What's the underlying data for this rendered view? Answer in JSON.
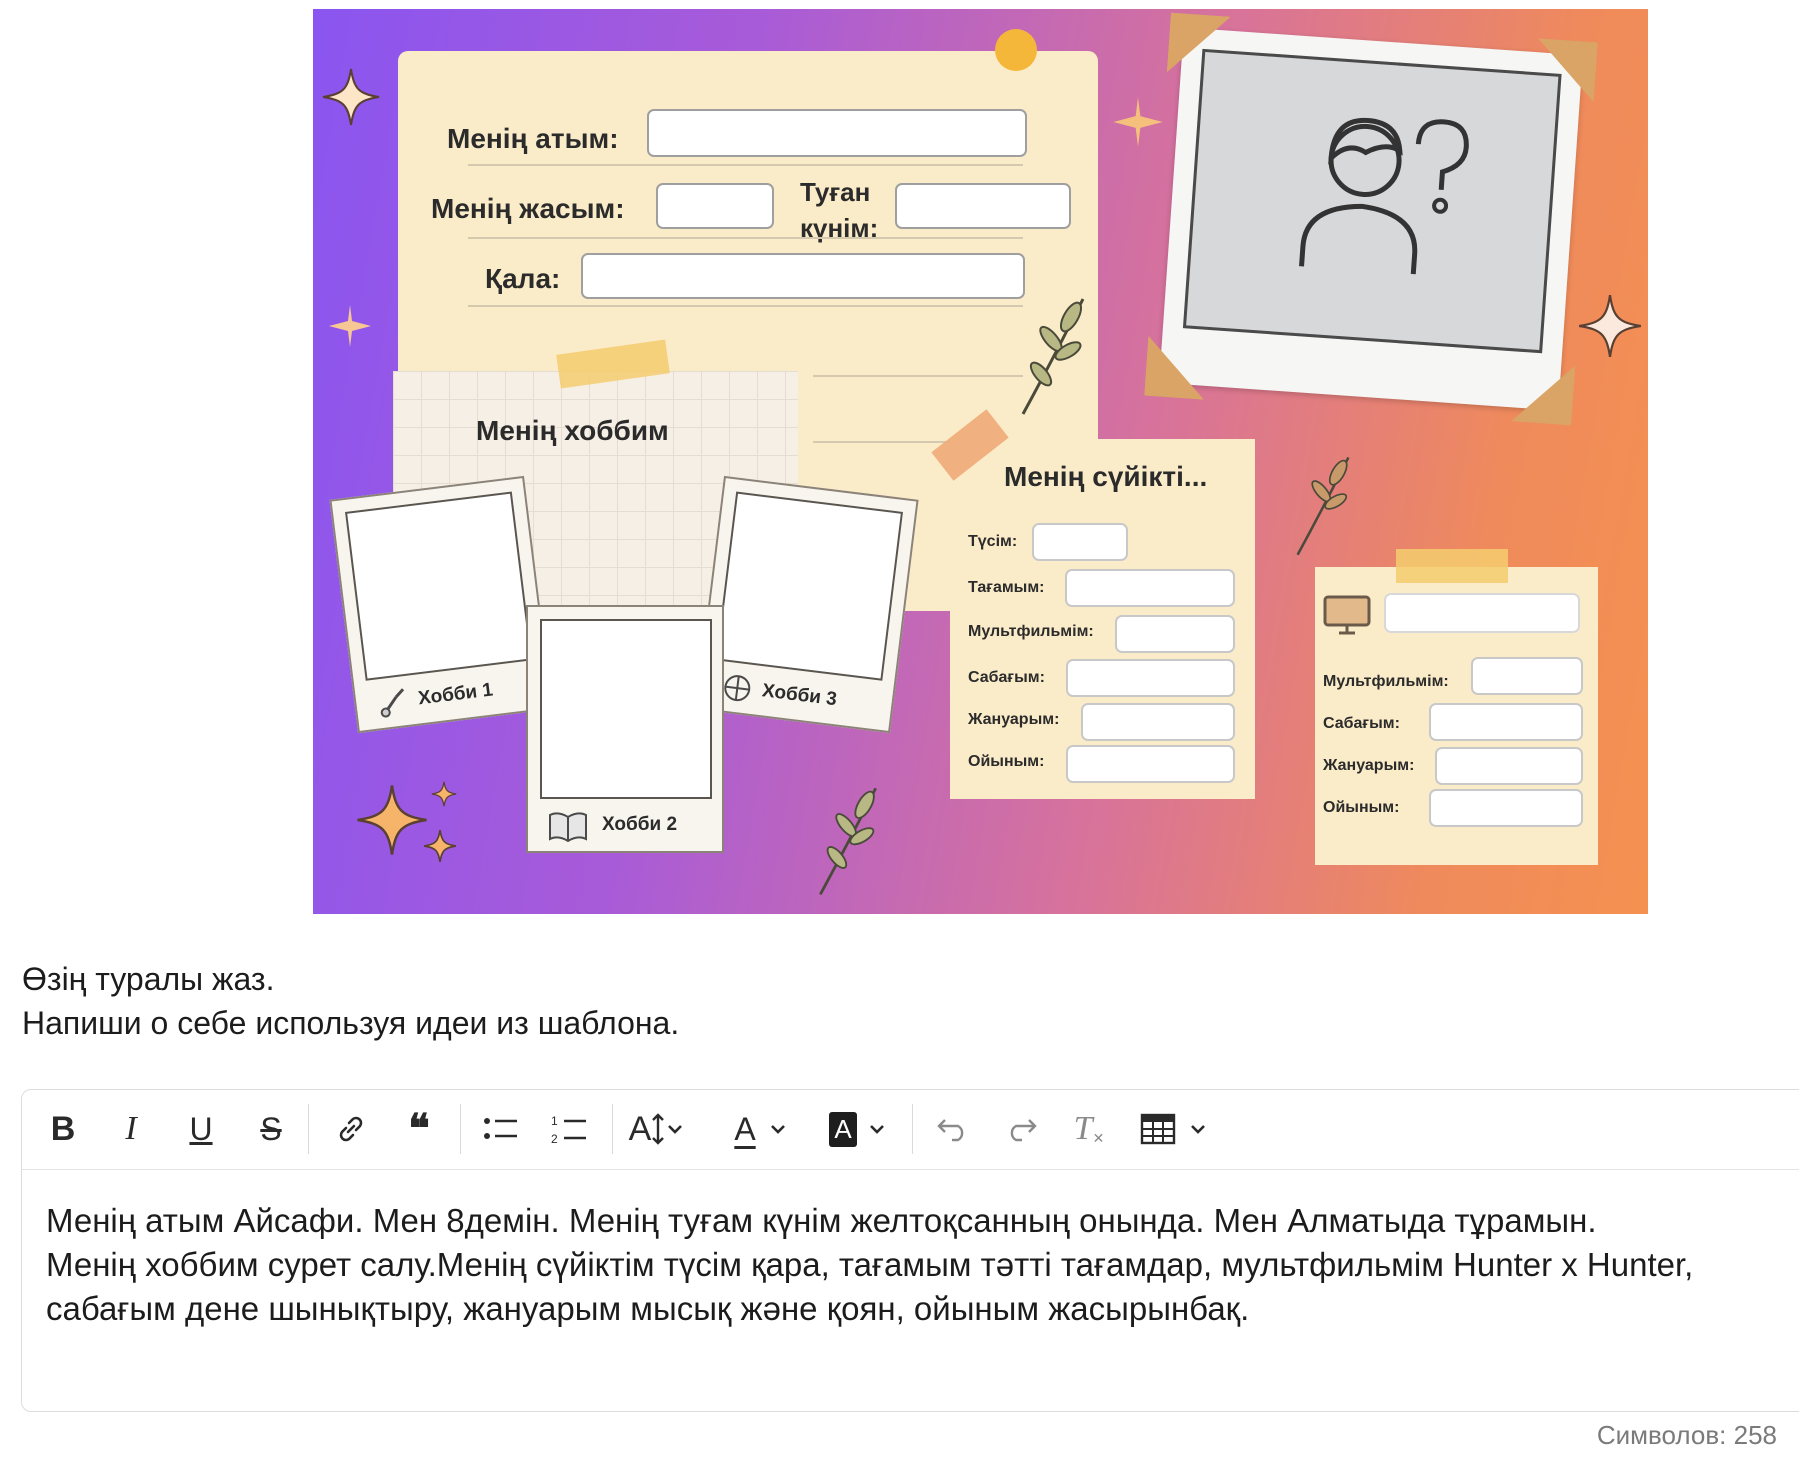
{
  "template": {
    "name_label": "Менің атым:",
    "age_label": "Менің жасым:",
    "birthday_label_line1": "Туған",
    "birthday_label_line2": "күнім:",
    "city_label": "Қала:",
    "hobby_title": "Менің хоббим",
    "hobbies": [
      "Хобби 1",
      "Хобби 2",
      "Хобби 3"
    ],
    "favorites_title": "Менің сүйікті...",
    "favorites_left": [
      "Түсім:",
      "Тағамым:",
      "Мультфильмім:",
      "Сабағым:",
      "Жануарым:",
      "Ойыным:"
    ],
    "favorites_right": [
      "Мультфильмім:",
      "Сабағым:",
      "Жануарым:",
      "Ойыным:"
    ]
  },
  "instructions": {
    "line1": "Өзің туралы жаз.",
    "line2": "Напиши о себе используя идеи из шаблона."
  },
  "toolbar": {
    "bold": "B",
    "italic": "I",
    "underline": "U",
    "strike": "S",
    "quote": "❝",
    "font_size": "A",
    "text_color": "A",
    "highlight": "A",
    "clear_format": "T"
  },
  "editor": {
    "lines": [
      "Менің атым Айсафи. Мен 8демін. Менің туғам күнім желтоқсанның онында. Мен Алматыда тұрамын.",
      "Менің хоббим сурет салу.Менің сүйіктім түсім қара, тағамым тәтті тағамдар, мультфильмім Hunter x Hunter,",
      "сабағым дене шынықтыру, жануарым мысық және қоян, ойыным жасырынбақ."
    ]
  },
  "counter": "Символов: 258",
  "colors": {
    "gradient_start": "#8a55f0",
    "gradient_end": "#f59150",
    "paper": "#fbecc9"
  }
}
